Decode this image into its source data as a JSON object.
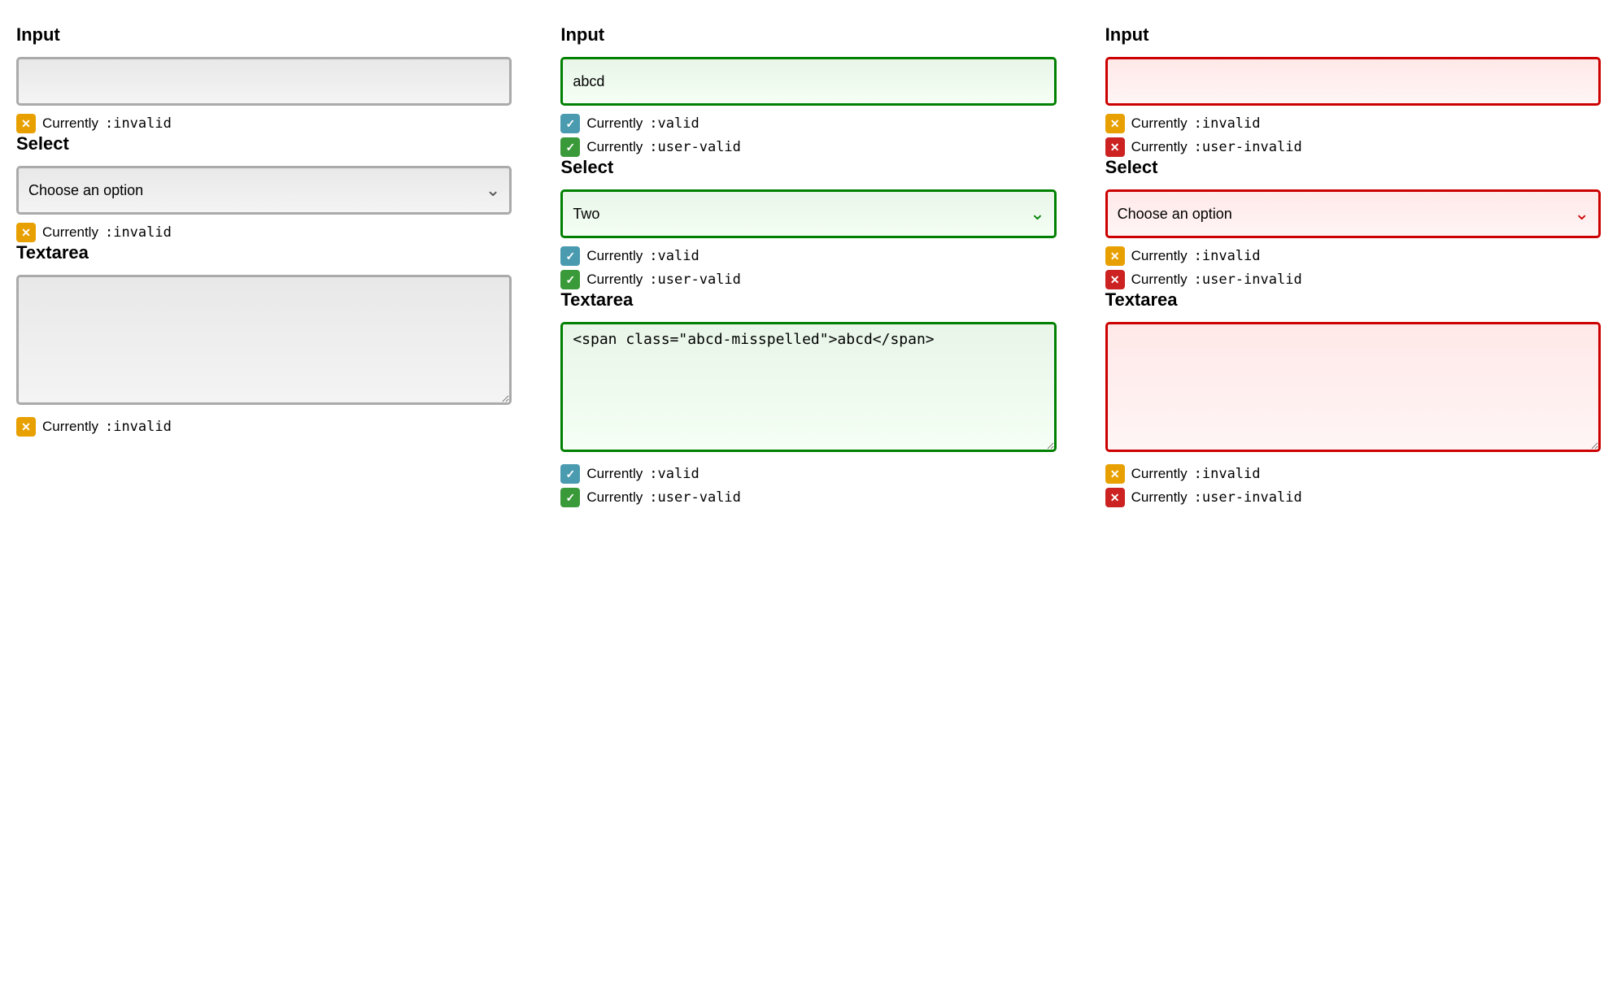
{
  "columns": [
    {
      "id": "col-default",
      "sections": [
        {
          "type": "input",
          "label": "Input",
          "inputStyle": "default",
          "value": "",
          "placeholder": "",
          "statuses": [
            {
              "badgeType": "orange",
              "text": "Currently",
              "pseudo": ":invalid"
            }
          ]
        },
        {
          "type": "select",
          "label": "Select",
          "selectStyle": "default",
          "value": "",
          "placeholder": "Choose an option",
          "chevronColor": "default",
          "statuses": [
            {
              "badgeType": "orange",
              "text": "Currently",
              "pseudo": ":invalid"
            }
          ]
        },
        {
          "type": "textarea",
          "label": "Textarea",
          "textareaStyle": "default",
          "value": "",
          "statuses": [
            {
              "badgeType": "orange",
              "text": "Currently",
              "pseudo": ":invalid"
            }
          ]
        }
      ]
    },
    {
      "id": "col-valid",
      "sections": [
        {
          "type": "input",
          "label": "Input",
          "inputStyle": "valid",
          "value": "abcd",
          "placeholder": "",
          "statuses": [
            {
              "badgeType": "blue",
              "text": "Currently",
              "pseudo": ":valid"
            },
            {
              "badgeType": "green",
              "text": "Currently",
              "pseudo": ":user-valid"
            }
          ]
        },
        {
          "type": "select",
          "label": "Select",
          "selectStyle": "valid",
          "value": "Two",
          "placeholder": "Two",
          "chevronColor": "green",
          "statuses": [
            {
              "badgeType": "blue",
              "text": "Currently",
              "pseudo": ":valid"
            },
            {
              "badgeType": "green",
              "text": "Currently",
              "pseudo": ":user-valid"
            }
          ]
        },
        {
          "type": "textarea",
          "label": "Textarea",
          "textareaStyle": "valid",
          "value": "abcd",
          "statuses": [
            {
              "badgeType": "blue",
              "text": "Currently",
              "pseudo": ":valid"
            },
            {
              "badgeType": "green",
              "text": "Currently",
              "pseudo": ":user-valid"
            }
          ]
        }
      ]
    },
    {
      "id": "col-invalid",
      "sections": [
        {
          "type": "input",
          "label": "Input",
          "inputStyle": "invalid-red",
          "value": "",
          "placeholder": "",
          "statuses": [
            {
              "badgeType": "orange",
              "text": "Currently",
              "pseudo": ":invalid"
            },
            {
              "badgeType": "red",
              "text": "Currently",
              "pseudo": ":user-invalid"
            }
          ]
        },
        {
          "type": "select",
          "label": "Select",
          "selectStyle": "invalid-red",
          "value": "",
          "placeholder": "Choose an option",
          "chevronColor": "red",
          "statuses": [
            {
              "badgeType": "orange",
              "text": "Currently",
              "pseudo": ":invalid"
            },
            {
              "badgeType": "red",
              "text": "Currently",
              "pseudo": ":user-invalid"
            }
          ]
        },
        {
          "type": "textarea",
          "label": "Textarea",
          "textareaStyle": "invalid-red",
          "value": "",
          "statuses": [
            {
              "badgeType": "orange",
              "text": "Currently",
              "pseudo": ":invalid"
            },
            {
              "badgeType": "red",
              "text": "Currently",
              "pseudo": ":user-invalid"
            }
          ]
        }
      ]
    }
  ],
  "badges": {
    "orange": "✕",
    "blue": "✓",
    "green": "✓",
    "red": "✕"
  },
  "chevrons": {
    "default": "∨",
    "green": "∨",
    "red": "∨"
  }
}
